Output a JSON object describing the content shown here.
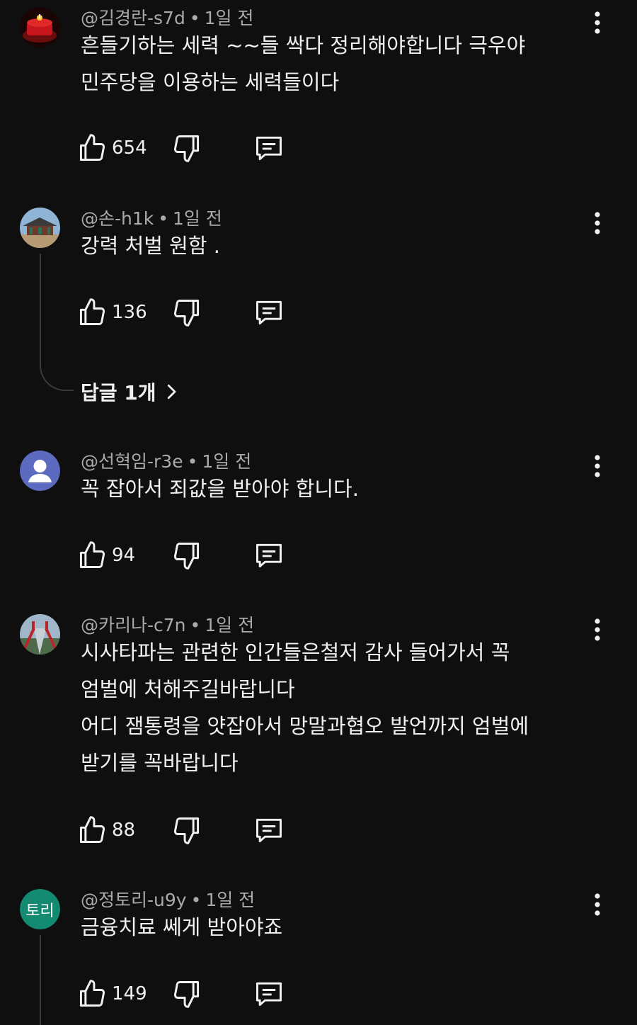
{
  "comments": [
    {
      "handle": "@김경란-s7d",
      "time": "1일 전",
      "lines": [
        "흔들기하는 세력 ~~들  싹다 정리해야합니다  극우야",
        "민주당을 이용하는 세력들이다"
      ],
      "likes": "654",
      "avatar": "red-cake-photo"
    },
    {
      "handle": "@손-h1k",
      "time": "1일 전",
      "lines": [
        "강력 처벌 원함 ."
      ],
      "likes": "136",
      "avatar": "palace-photo",
      "replies": "답글 1개"
    },
    {
      "handle": "@선혁임-r3e",
      "time": "1일 전",
      "lines": [
        "꼭 잡아서 죄값을 받아야 합니다."
      ],
      "likes": "94",
      "avatar": "default-person-icon",
      "avatar_color": "#5c6bc0"
    },
    {
      "handle": "@카리나-c7n",
      "time": "1일 전",
      "lines": [
        "시사타파는 관련한 인간들은철저 감사 들어가서 꼭",
        "엄벌에 처해주길바랍니다",
        "어디 잼통령을 얏잡아서 망말과협오 발언까지 엄벌에",
        "받기를 꼭바랍니다"
      ],
      "likes": "88",
      "avatar": "bridge-photo"
    },
    {
      "handle": "@정토리-u9y",
      "time": "1일 전",
      "lines": [
        "금융치료 쎄게 받아야죠"
      ],
      "likes": "149",
      "avatar": "text-avatar",
      "avatar_text": "토리",
      "avatar_color": "#138a72"
    }
  ],
  "meta_separator": "•",
  "theme": {
    "background": "#0f0f0f",
    "text": "#f1f1f1",
    "secondary_text": "#aaaaaa"
  }
}
